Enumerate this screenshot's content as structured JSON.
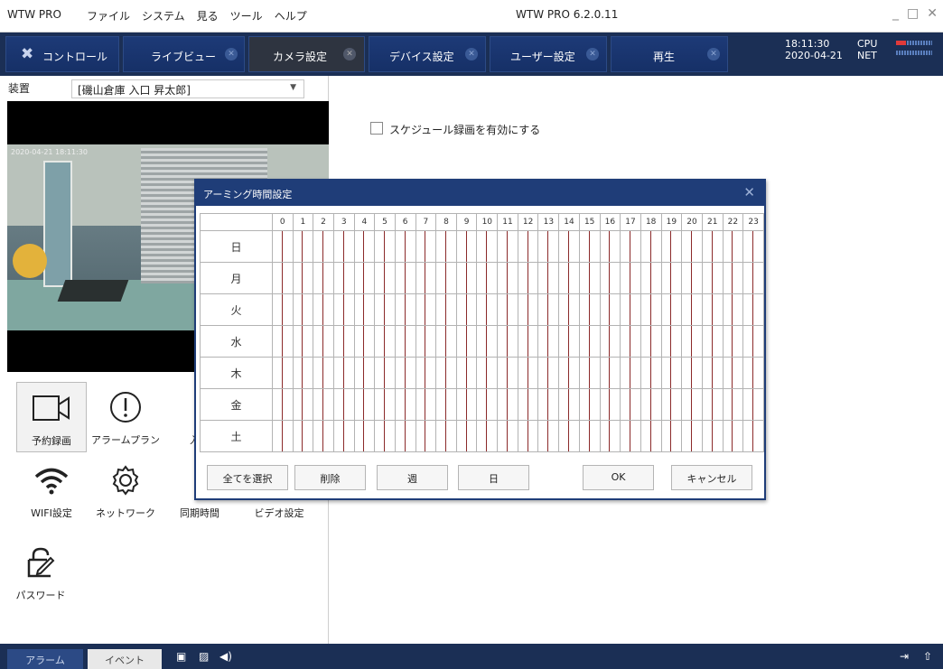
{
  "app": {
    "name": "WTW PRO",
    "menus": [
      "ファイル",
      "システム",
      "見る",
      "ツール",
      "ヘルプ"
    ],
    "window_title": "WTW PRO 6.2.0.11"
  },
  "tabs": [
    {
      "label": "コントロール",
      "closable": false,
      "icon": "tools-icon"
    },
    {
      "label": "ライブビュー",
      "closable": true
    },
    {
      "label": "カメラ設定",
      "closable": true,
      "active": true
    },
    {
      "label": "デバイス設定",
      "closable": true
    },
    {
      "label": "ユーザー設定",
      "closable": true
    },
    {
      "label": "再生",
      "closable": true
    }
  ],
  "status": {
    "time": "18:11:30",
    "date": "2020-04-21",
    "cpu_label": "CPU",
    "net_label": "NET"
  },
  "device": {
    "label": "装置",
    "selected": "[磯山倉庫 入口 昇太郎]"
  },
  "camera": {
    "timestamp": "2020-04-21 18:11:30"
  },
  "functions": [
    {
      "label": "予約録画",
      "icon": "camera-icon",
      "selected": true
    },
    {
      "label": "アラームプラン",
      "icon": "alert-icon"
    },
    {
      "label": "入力",
      "icon": "input-icon"
    },
    {
      "label": "WIFI設定",
      "icon": "wifi-icon"
    },
    {
      "label": "ネットワーク",
      "icon": "gear-icon"
    },
    {
      "label": "同期時間",
      "icon": "clock-icon"
    },
    {
      "label": "ビデオ設定",
      "icon": "video-icon"
    },
    {
      "label": "パスワード",
      "icon": "lock-icon"
    }
  ],
  "schedule": {
    "enable_label": "スケジュール録画を有効にする",
    "enabled": false
  },
  "dialog": {
    "title": "アーミング時間設定",
    "hours": [
      "0",
      "1",
      "2",
      "3",
      "4",
      "5",
      "6",
      "7",
      "8",
      "9",
      "10",
      "11",
      "12",
      "13",
      "14",
      "15",
      "16",
      "17",
      "18",
      "19",
      "20",
      "21",
      "22",
      "23"
    ],
    "days": [
      "日",
      "月",
      "火",
      "水",
      "木",
      "金",
      "土"
    ],
    "buttons": {
      "select_all": "全てを選択",
      "delete": "削除",
      "week": "週",
      "day": "日",
      "ok": "OK",
      "cancel": "キャンセル"
    }
  },
  "bottom": {
    "alarm_tab": "アラーム",
    "event_tab": "イベント"
  },
  "colors": {
    "navy": "#1b2f55",
    "dialog_header": "#1f3d78",
    "grid_divider": "#8b2a2a"
  }
}
